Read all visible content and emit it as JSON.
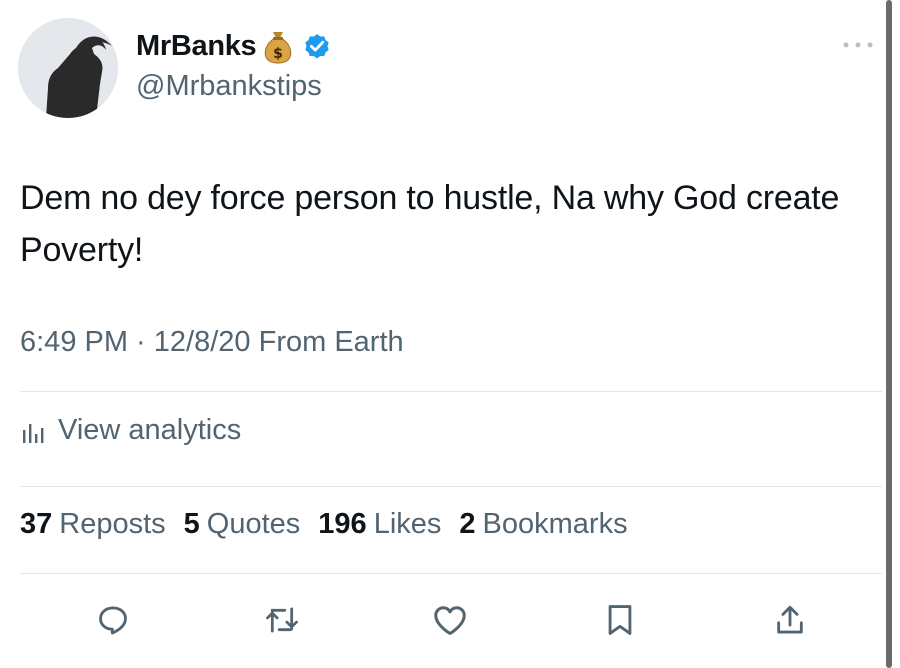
{
  "author": {
    "display_name": "MrBanks",
    "emoji_icon": "money-bag-icon",
    "verified_icon": "verified-badge-icon",
    "handle": "@Mrbankstips"
  },
  "tweet": {
    "text": "Dem no dey force person to hustle, Na why God create Poverty!",
    "time": "6:49 PM",
    "separator": " · ",
    "date": "12/8/20",
    "source": " From Earth"
  },
  "analytics": {
    "label": "View analytics",
    "icon": "bar-chart-icon"
  },
  "stats": [
    {
      "count": "37",
      "label": "Reposts"
    },
    {
      "count": "5",
      "label": "Quotes"
    },
    {
      "count": "196",
      "label": "Likes"
    },
    {
      "count": "2",
      "label": "Bookmarks"
    }
  ],
  "actions": [
    "reply-icon",
    "repost-icon",
    "like-icon",
    "bookmark-icon",
    "share-icon"
  ],
  "colors": {
    "text": "#0f1419",
    "secondary": "#536471",
    "verified": "#1d9bf0",
    "divider": "#e4e7ea"
  }
}
